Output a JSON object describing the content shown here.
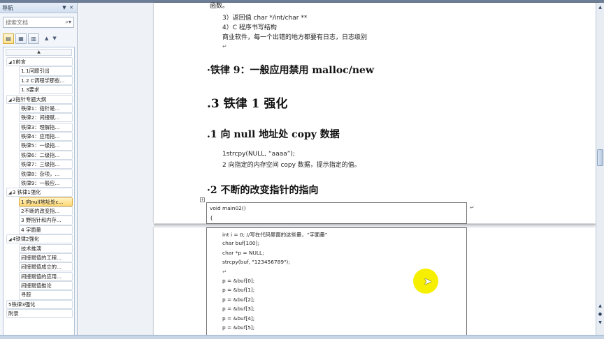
{
  "nav": {
    "title": "导航",
    "search_placeholder": "搜索文档",
    "collapse_label": "▲",
    "items": [
      {
        "label": "1前言",
        "level": 1,
        "tri": "◢"
      },
      {
        "label": "1.1问题引出",
        "level": 2
      },
      {
        "label": "1.2 C调程学那些...",
        "level": 2
      },
      {
        "label": "1.3要求",
        "level": 2
      },
      {
        "label": "2指针专题大纲",
        "level": 1,
        "tri": "◢"
      },
      {
        "label": "铁律1：指针是...",
        "level": 2
      },
      {
        "label": "铁律2：间接赋...",
        "level": 2
      },
      {
        "label": "铁律3：理解指...",
        "level": 2
      },
      {
        "label": "铁律4：应用指...",
        "level": 2
      },
      {
        "label": "铁律5：一级指...",
        "level": 2
      },
      {
        "label": "铁律6：二级指...",
        "level": 2
      },
      {
        "label": "铁律7：三级指...",
        "level": 2
      },
      {
        "label": "铁律8：杂项，...",
        "level": 2
      },
      {
        "label": "铁律9：一般应...",
        "level": 2
      },
      {
        "label": "3 铁律1强化",
        "level": 1,
        "tri": "◢"
      },
      {
        "label": "1 向null地址处c...",
        "level": 2,
        "selected": true
      },
      {
        "label": "2不断的改变指...",
        "level": 2
      },
      {
        "label": "3 野指针和内存...",
        "level": 2
      },
      {
        "label": "4 字面量",
        "level": 2
      },
      {
        "label": "4铁律2强化",
        "level": 1,
        "tri": "◢"
      },
      {
        "label": "技术推演",
        "level": 2
      },
      {
        "label": "间接赋值的工程...",
        "level": 2
      },
      {
        "label": "间接赋值成立的...",
        "level": 2
      },
      {
        "label": "间接赋值的应用...",
        "level": 2
      },
      {
        "label": "间接赋值推论",
        "level": 2
      },
      {
        "label": "寻踪",
        "level": 2
      },
      {
        "label": "5铁律3强化",
        "level": 1
      },
      {
        "label": "附录",
        "level": 1
      }
    ]
  },
  "doc": {
    "line_top": "函数。",
    "line_ret": "3）返回值 char */int/char **",
    "line_c": "4）C 程序书写结构",
    "line_log": "商业软件，每一个出错的地方都要有日志，日志级别",
    "h_rule9": "·铁律 9：一般应用禁用 malloc/new",
    "h_chapter": ".3  铁律 1 强化",
    "h_sec1": ".1  向 null 地址处 copy 数据",
    "strcpy_line": "1strcpy(NULL, “aaaa”);",
    "strcpy_desc": "2 向指定的内存空间 copy 数据，提示指定的值。",
    "h_sec2": "·2 不断的改变指针的指向",
    "code_a": "void main02()",
    "code_b": "{",
    "code_lines": [
      "int i = 0; //写在代码里面的这些量，“字面量”",
      "char buf[100];",
      "char *p    = NULL;",
      "strcpy(buf, \"123456789\");",
      "",
      "p = &buf[0];",
      "p = &buf[1];",
      "p = &buf[2];",
      "p = &buf[3];",
      "p = &buf[4];",
      "p = &buf[5];"
    ],
    "para_mark": "↵"
  },
  "colors": {
    "nav_bg": "#f2f6fb",
    "selected": "#ffd877",
    "cursor_highlight": "#f6ef00"
  }
}
